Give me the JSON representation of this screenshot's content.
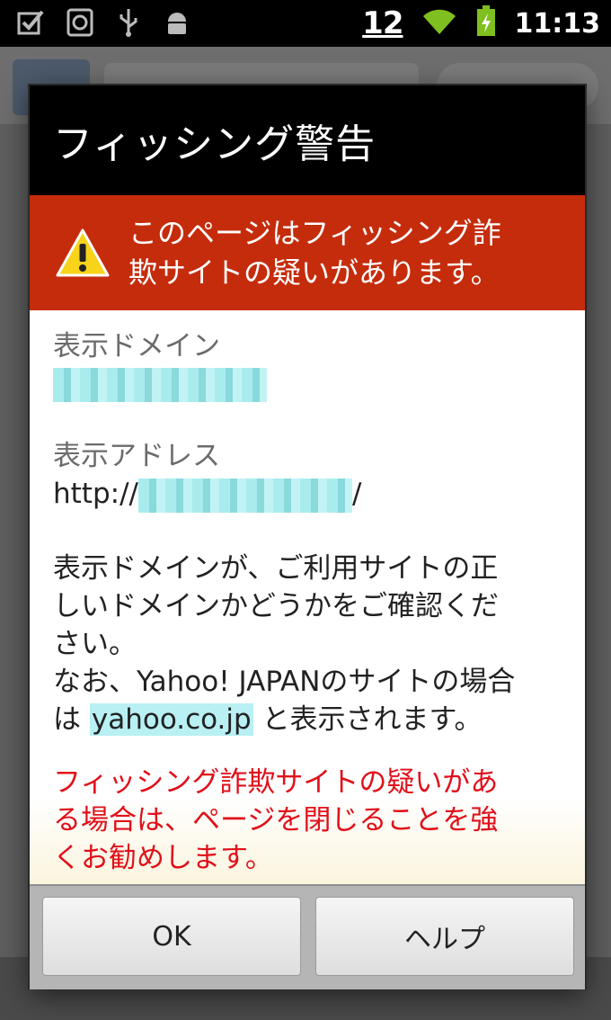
{
  "status_bar": {
    "signal_text": "12",
    "time": "11:13",
    "icons": [
      "checkbox-icon",
      "sync-icon",
      "usb-icon",
      "android-icon",
      "wifi-icon",
      "battery-icon"
    ]
  },
  "dialog": {
    "title": "フィッシング警告",
    "warning_line1": "このページはフィッシング詐",
    "warning_line2": "欺サイトの疑いがあります。",
    "domain_label": "表示ドメイン",
    "address_label": "表示アドレス",
    "address_prefix": "http://",
    "address_suffix": "/",
    "para1_line1": "表示ドメインが、ご利用サイトの正",
    "para1_line2": "しいドメインかどうかをご確認くだ",
    "para1_line3": "さい。",
    "para2_line1": "なお、Yahoo! JAPANのサイトの場合",
    "para2_prefix": "は",
    "para2_highlight": "yahoo.co.jp",
    "para2_suffix": "と表示されます。",
    "red_line1": "フィッシング詐欺サイトの疑いがあ",
    "red_line2": "る場合は、ページを閉じることを強",
    "red_line3": "くお勧めします。",
    "ok_label": "OK",
    "help_label": "ヘルプ"
  },
  "colors": {
    "warning_banner": "#c52c0c",
    "red_text": "#e0101a",
    "highlight": "#b8f0f3"
  }
}
